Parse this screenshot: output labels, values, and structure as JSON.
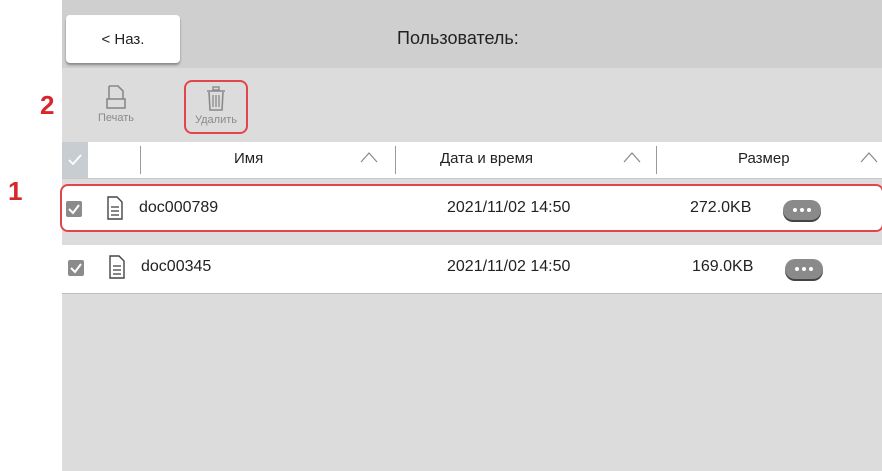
{
  "header": {
    "back_label": "< Наз.",
    "title": "Пользователь:"
  },
  "toolbar": {
    "print_label": "Печать",
    "delete_label": "Удалить"
  },
  "callouts": {
    "one": "1",
    "two": "2"
  },
  "columns": {
    "name": "Имя",
    "datetime": "Дата и время",
    "size": "Размер"
  },
  "files": [
    {
      "name": "doc000789",
      "datetime": "2021/11/02 14:50",
      "size": "272.0KB",
      "checked": true,
      "highlighted": true
    },
    {
      "name": "doc00345",
      "datetime": "2021/11/02 14:50",
      "size": "169.0KB",
      "checked": true,
      "highlighted": false
    }
  ],
  "colors": {
    "accent_highlight": "#e0474c",
    "callout": "#d9262c"
  },
  "icons": {
    "print": "document-icon",
    "delete": "trash-icon",
    "file": "file-icon",
    "more": "more-icon"
  }
}
